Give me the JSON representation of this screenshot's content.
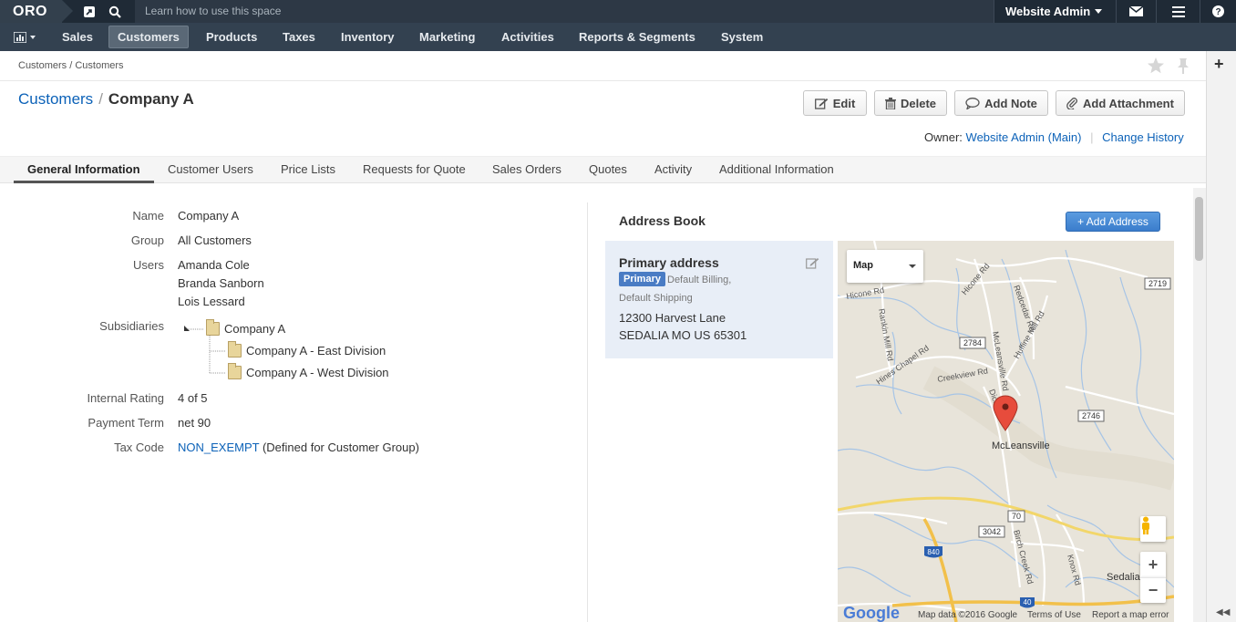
{
  "topbar": {
    "logo": "ORO",
    "search_placeholder": "Learn how to use this space",
    "user_name": "Website Admin"
  },
  "nav": {
    "items": [
      "Sales",
      "Customers",
      "Products",
      "Taxes",
      "Inventory",
      "Marketing",
      "Activities",
      "Reports & Segments",
      "System"
    ],
    "active": "Customers"
  },
  "breadcrumb": "Customers / Customers",
  "page": {
    "title_link": "Customers",
    "title_sep": "/",
    "title": "Company A"
  },
  "actions": {
    "edit": "Edit",
    "delete": "Delete",
    "add_note": "Add Note",
    "add_attachment": "Add Attachment"
  },
  "owner": {
    "label": "Owner:",
    "name": "Website Admin",
    "org": "(Main)",
    "org_link": "Main",
    "change_history": "Change History"
  },
  "tabs": [
    "General Information",
    "Customer Users",
    "Price Lists",
    "Requests for Quote",
    "Sales Orders",
    "Quotes",
    "Activity",
    "Additional Information"
  ],
  "general": {
    "name_label": "Name",
    "name": "Company A",
    "group_label": "Group",
    "group": "All Customers",
    "users_label": "Users",
    "users": [
      "Amanda Cole",
      "Branda Sanborn",
      "Lois Lessard"
    ],
    "subsidiaries_label": "Subsidiaries",
    "subsidiaries": {
      "root": "Company A",
      "children": [
        "Company A - East Division",
        "Company A - West Division"
      ]
    },
    "rating_label": "Internal Rating",
    "rating": "4 of 5",
    "payment_label": "Payment Term",
    "payment": "net 90",
    "tax_label": "Tax Code",
    "tax_code": "NON_EXEMPT",
    "tax_note": "(Defined for Customer Group)"
  },
  "address_book": {
    "title": "Address Book",
    "add_button": "+ Add Address",
    "card": {
      "title": "Primary address",
      "badge": "Primary",
      "types_line1": "Default Billing,",
      "types_line2": "Default Shipping",
      "street": "12300 Harvest Lane",
      "city_line": "SEDALIA MO US 65301"
    }
  },
  "map": {
    "type_label": "Map",
    "city": "McLeansville",
    "city2": "Sedalia",
    "roads": [
      "Hicone Rd",
      "Redcedar Rd",
      "Huffine Mill Rd",
      "McLeansville Rd",
      "Rankin Mill Rd",
      "Hines Chapel Rd",
      "Creekview Rd",
      "Birch Creek Rd",
      "Knox Rd",
      "Dick Rd"
    ],
    "shields": [
      "2719",
      "2784",
      "2746",
      "70",
      "3042",
      "840",
      "40"
    ],
    "footer_data": "Map data ©2016 Google",
    "footer_terms": "Terms of Use",
    "footer_report": "Report a map error",
    "google": "Google"
  }
}
